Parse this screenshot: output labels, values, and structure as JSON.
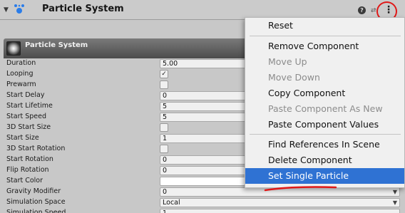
{
  "header": {
    "title": "Particle System",
    "fold_glyph": "▼",
    "help_glyph": "?",
    "preset_glyph": "⇄",
    "menu_glyph": "⋮",
    "icon": "particle-system-icon"
  },
  "panel": {
    "title": "Particle System",
    "rows": [
      {
        "label": "Duration",
        "kind": "text",
        "value": "5.00"
      },
      {
        "label": "Looping",
        "kind": "check",
        "value": "✓"
      },
      {
        "label": "Prewarm",
        "kind": "check",
        "value": ""
      },
      {
        "label": "Start Delay",
        "kind": "text",
        "value": "0"
      },
      {
        "label": "Start Lifetime",
        "kind": "text",
        "value": "5"
      },
      {
        "label": "Start Speed",
        "kind": "text",
        "value": "5"
      },
      {
        "label": "3D Start Size",
        "kind": "check",
        "value": ""
      },
      {
        "label": "Start Size",
        "kind": "text",
        "value": "1"
      },
      {
        "label": "3D Start Rotation",
        "kind": "check",
        "value": ""
      },
      {
        "label": "Start Rotation",
        "kind": "text",
        "value": "0"
      },
      {
        "label": "Flip Rotation",
        "kind": "text",
        "value": "0"
      },
      {
        "label": "Start Color",
        "kind": "color",
        "value": ""
      },
      {
        "label": "Gravity Modifier",
        "kind": "dropdown",
        "value": "0",
        "arrow": "▼"
      },
      {
        "label": "Simulation Space",
        "kind": "dropdown",
        "value": "Local",
        "arrow": "▼"
      },
      {
        "label": "Simulation Speed",
        "kind": "text",
        "value": "1"
      }
    ]
  },
  "menu": {
    "items": [
      {
        "label": "Reset",
        "state": "enabled"
      },
      {
        "label": "Remove Component",
        "state": "enabled"
      },
      {
        "label": "Move Up",
        "state": "disabled"
      },
      {
        "label": "Move Down",
        "state": "disabled"
      },
      {
        "label": "Copy Component",
        "state": "enabled"
      },
      {
        "label": "Paste Component As New",
        "state": "disabled"
      },
      {
        "label": "Paste Component Values",
        "state": "enabled"
      },
      {
        "label": "Find References In Scene",
        "state": "enabled"
      },
      {
        "label": "Delete Component",
        "state": "enabled"
      },
      {
        "label": "Set Single Particle",
        "state": "highlighted"
      }
    ]
  },
  "colors": {
    "highlight": "#2f72d3",
    "annotation": "#e01818"
  }
}
